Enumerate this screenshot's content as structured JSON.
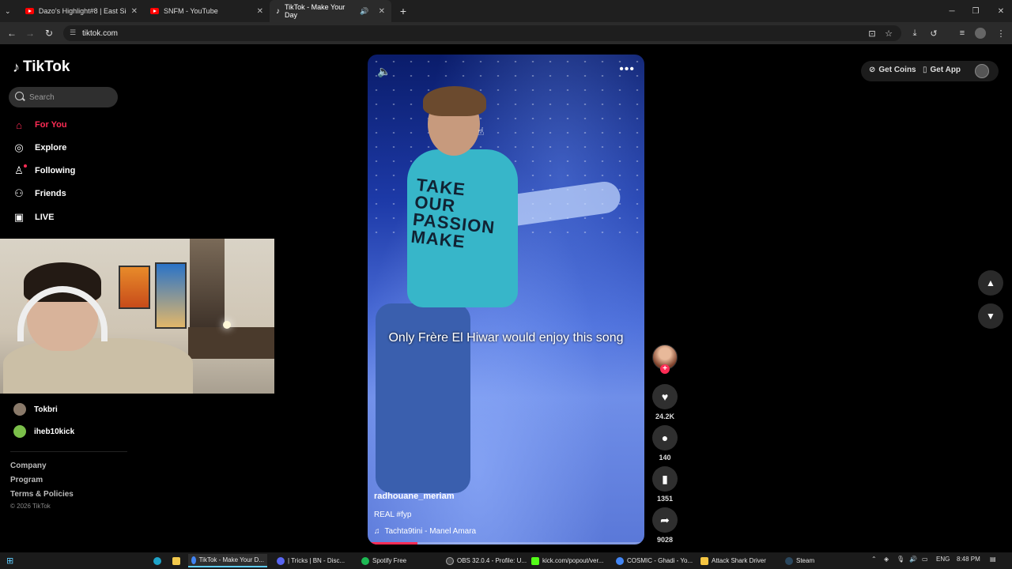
{
  "browser": {
    "tabs": [
      {
        "title": "Dazo's Highlight#8 | East Side B",
        "icon": "youtube-icon"
      },
      {
        "title": "SNFM - YouTube",
        "icon": "youtube-icon"
      },
      {
        "title": "TikTok - Make Your Day",
        "icon": "tiktok-icon",
        "audio": "🔊"
      }
    ],
    "new_tab": "+",
    "url": "tiktok.com"
  },
  "sidebar": {
    "brand": "TikTok",
    "search_placeholder": "Search",
    "nav": [
      {
        "label": "For You",
        "icon": "home-icon",
        "active": true
      },
      {
        "label": "Explore",
        "icon": "compass-icon"
      },
      {
        "label": "Following",
        "icon": "following-icon"
      },
      {
        "label": "Friends",
        "icon": "friends-icon"
      },
      {
        "label": "LIVE",
        "icon": "live-icon"
      }
    ],
    "accounts": [
      {
        "name": "Tokbri"
      },
      {
        "name": "iheb10kick"
      }
    ],
    "footer": [
      "Company",
      "Program",
      "Terms & Policies"
    ],
    "copyright": "© 2026 TikTok"
  },
  "video": {
    "shirt_text": "TAKE OUR PASSION MAKE",
    "caption": "Only Frère El Hiwar would enjoy this song",
    "author": "radhouane_meriam",
    "description": "REAL #fyp",
    "music": "Tachta9tini - Manel Amara",
    "progress": 0.18
  },
  "actions": {
    "likes": "24.2K",
    "comments": "140",
    "saves": "1351",
    "shares": "9028"
  },
  "topright": {
    "coins": "Get Coins",
    "app": "Get App"
  },
  "taskbar": {
    "items": [
      {
        "label": "TikTok - Make Your D...",
        "color": "#4285f4",
        "active": true
      },
      {
        "label": "| Tricks | BN - Disc...",
        "color": "#5865f2"
      },
      {
        "label": "Spotify Free",
        "color": "#1db954"
      },
      {
        "label": "OBS 32.0.4 - Profile: U...",
        "color": "#444444"
      },
      {
        "label": "kick.com/popout/ver...",
        "color": "#53fc18"
      },
      {
        "label": "COSMIC - Ghadi - Yo...",
        "color": "#4285f4"
      },
      {
        "label": "Attack Shark Driver",
        "color": "#f5c542"
      },
      {
        "label": "Steam",
        "color": "#1b2838"
      }
    ],
    "language": "ENG",
    "time": "8:48 PM"
  },
  "colors": {
    "accent": "#fe2c55",
    "background": "#000000"
  }
}
